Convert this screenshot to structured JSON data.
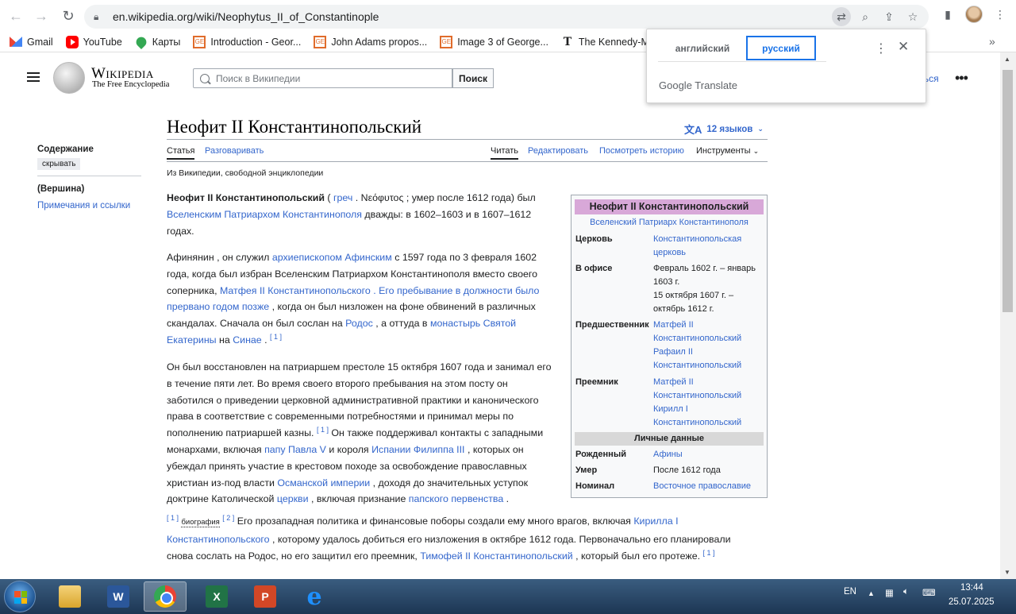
{
  "browser": {
    "url": "en.wikipedia.org/wiki/Neophytus_II_of_Constantinople",
    "bookmarks": [
      "Gmail",
      "YouTube",
      "Карты",
      "Introduction - Geor...",
      "John Adams propos...",
      "Image 3 of George...",
      "The Kennedy-Mac"
    ]
  },
  "translate_popup": {
    "lang_source": "английский",
    "lang_target": "русский",
    "brand": "Google Translate"
  },
  "wiki": {
    "wordmark": "Wikipedia",
    "tagline": "The Free Encyclopedia",
    "search_placeholder": "Поиск в Википедии",
    "search_button": "Поиск",
    "header_link": "аться",
    "toc": {
      "title": "Содержание",
      "hide": "скрывать",
      "top": "(Вершина)",
      "notes": "Примечания и ссылки"
    },
    "title": "Неофит II Константинопольский",
    "languages": "12 языков",
    "tabs": {
      "article": "Статья",
      "talk": "Разговаривать",
      "read": "Читать",
      "edit": "Редактировать",
      "history": "Посмотреть историю",
      "tools": "Инструменты"
    },
    "from_wikipedia": "Из Википедии, свободной энциклопедии"
  },
  "article": {
    "p1": {
      "name": "Неофит II Константинопольский",
      "t1": " ( ",
      "greek_link": "греч",
      "t2": " . Νεόφυτος ; умер после 1612 года) был ",
      "patriarch_link": "Вселенским Патриархом Константинополя",
      "t3": " дважды: в 1602–1603 и в 1607–1612 годах."
    },
    "p2": {
      "t1": "Афинянин , он служил ",
      "link1": "архиепископом Афинским",
      "t2": " с 1597 года по 3 февраля 1602 года, когда был избран Вселенским Патриархом Константинополя вместо своего соперника, ",
      "link2": "Матфея II Константинопольского . Его пребывание в должности было прервано годом позже",
      "t3": " , когда он был низложен на фоне обвинений в различных скандалах. Сначала он был сослан на ",
      "link3": "Родос",
      "t4": " , а оттуда в ",
      "link4": "монастырь Святой Екатерины",
      "t5": " на ",
      "link5": "Синае",
      "t6": " . ",
      "ref": "[ 1 ]"
    },
    "p3": {
      "t1": "Он был восстановлен на патриаршем престоле 15 октября 1607 года и занимал его в течение пяти лет. Во время своего второго пребывания на этом посту он заботился о приведении церковной административной практики и канонического права в соответствие с современными потребностями и принимал меры по пополнению патриаршей казны. ",
      "ref1": "[ 1 ]",
      "t2": " Он также поддерживал контакты с западными монархами, включая ",
      "link1": "папу Павла V",
      "t3": " и короля ",
      "link2": "Испании Филиппа III",
      "t4": " , которых он убеждал принять участие в крестовом походе за освобождение православных христиан из-под власти ",
      "link3": "Османской империи",
      "t5": " , доходя до значительных уступок доктрине Католической ",
      "link4": "церкви",
      "t6": " , включая признание ",
      "link5": "папского первенства",
      "t7": " ."
    },
    "p4": {
      "ref1": "[ 1 ]",
      "tag": "биография",
      "ref2": "[ 2 ]",
      "t1": " Его прозападная политика и финансовые поборы создали ему много врагов, включая ",
      "link1": "Кирилла I Константинопольского",
      "t2": " , которому удалось добиться его низложения в октябре 1612 года. Первоначально его планировали снова сослать на Родос, но его защитил его преемник, ",
      "link2": "Тимофей II Константинопольский",
      "t3": " , который был его протеже. ",
      "ref3": "[ 1 ]"
    }
  },
  "infobox": {
    "title": "Неофит II Константинопольский",
    "subtitle": "Вселенский Патриарх Константинополя",
    "church_label": "Церковь",
    "church_value": "Константинопольская церковь",
    "office_label": "В офисе",
    "office_value_1": "Февраль 1602 г. – январь 1603 г.",
    "office_value_2": "15 октября 1607 г. – октябрь 1612 г.",
    "predecessor_label": "Предшественник",
    "predecessor_1": "Матфей II Константинопольский",
    "predecessor_2": "Рафаил II Константинопольский",
    "successor_label": "Преемник",
    "successor_1": "Матфей II Константинопольский",
    "successor_2": "Кирилл I Константинопольский",
    "personal_section": "Личные данные",
    "born_label": "Рожденный",
    "born_value": "Афины",
    "died_label": "Умер",
    "died_value": "После 1612 года",
    "denomination_label": "Номинал",
    "denomination_value": "Восточное православие"
  },
  "taskbar": {
    "lang": "EN",
    "time": "13:44",
    "date": "25.07.2025"
  }
}
